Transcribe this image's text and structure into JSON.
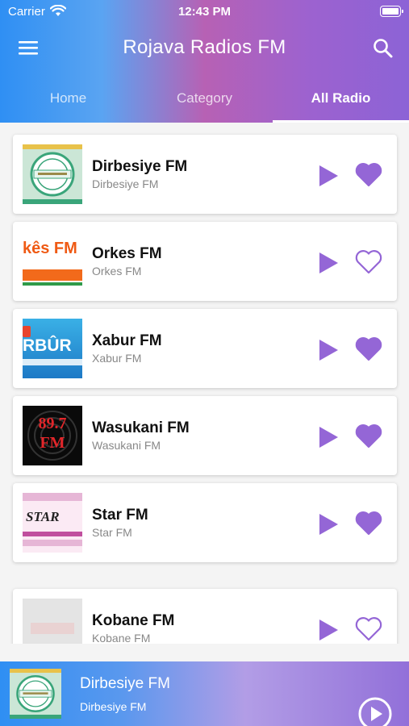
{
  "status_bar": {
    "carrier": "Carrier",
    "time": "12:43 PM"
  },
  "header": {
    "title": "Rojava Radios FM"
  },
  "tabs": [
    {
      "label": "Home",
      "active": false
    },
    {
      "label": "Category",
      "active": false
    },
    {
      "label": "All Radio",
      "active": true
    }
  ],
  "stations": [
    {
      "name": "Dirbesiye FM",
      "subtitle": "Dirbesiye FM",
      "favorite": true,
      "logo_text": ""
    },
    {
      "name": "Orkes FM",
      "subtitle": "Orkes FM",
      "favorite": false,
      "logo_text": "kês FM"
    },
    {
      "name": "Xabur FM",
      "subtitle": "Xabur FM",
      "favorite": true,
      "logo_text": "RBÛR"
    },
    {
      "name": "Wasukani FM",
      "subtitle": "Wasukani FM",
      "favorite": true,
      "logo_text": "89.7 FM"
    },
    {
      "name": "Star FM",
      "subtitle": "Star FM",
      "favorite": true,
      "logo_text": "STAR"
    },
    {
      "name": "Kobane FM",
      "subtitle": "Kobane FM",
      "favorite": false,
      "logo_text": ""
    }
  ],
  "now_playing": {
    "title": "Dirbesiye FM",
    "subtitle": "Dirbesiye FM"
  },
  "icons": {
    "menu": "menu-icon",
    "search": "search-icon",
    "play": "play-icon",
    "favorite": "heart-icon",
    "wifi": "wifi-icon",
    "battery": "battery-icon"
  },
  "colors": {
    "accent": "#9466d6",
    "header_start": "#2f8ff3",
    "header_end": "#8c63d6"
  }
}
